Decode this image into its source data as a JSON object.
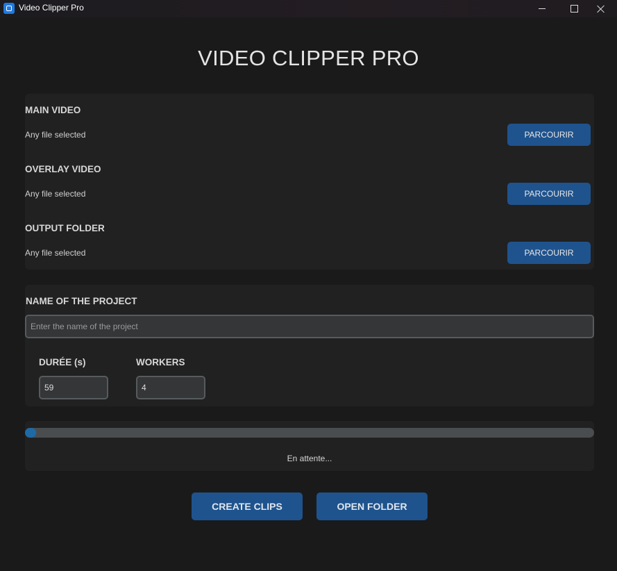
{
  "window": {
    "title": "Video Clipper Pro",
    "icon": "app-icon",
    "controls": [
      "minimize-icon",
      "maximize-icon",
      "close-icon"
    ]
  },
  "header": {
    "title": "VIDEO CLIPPER PRO"
  },
  "files": {
    "main_video": {
      "label": "MAIN VIDEO",
      "status": "Any file selected",
      "button": "PARCOURIR"
    },
    "overlay_video": {
      "label": "OVERLAY VIDEO",
      "status": "Any file selected",
      "button": "PARCOURIR"
    },
    "output_folder": {
      "label": "OUTPUT FOLDER",
      "status": "Any file selected",
      "button": "PARCOURIR"
    }
  },
  "project": {
    "label": "NAME OF THE PROJECT",
    "name_value": "",
    "name_placeholder": "Enter the name of the project",
    "duration_label": "DURÉE (s)",
    "duration_value": "59",
    "workers_label": "WORKERS",
    "workers_value": "4"
  },
  "progress": {
    "fraction": 0.02,
    "status": "En attente..."
  },
  "actions": {
    "create_clips": "CREATE CLIPS",
    "open_folder": "OPEN FOLDER"
  },
  "colors": {
    "accent": "#1f538d",
    "progress_fill": "#1f6aa5",
    "panel": "#212121",
    "background": "#1a1a1a"
  }
}
